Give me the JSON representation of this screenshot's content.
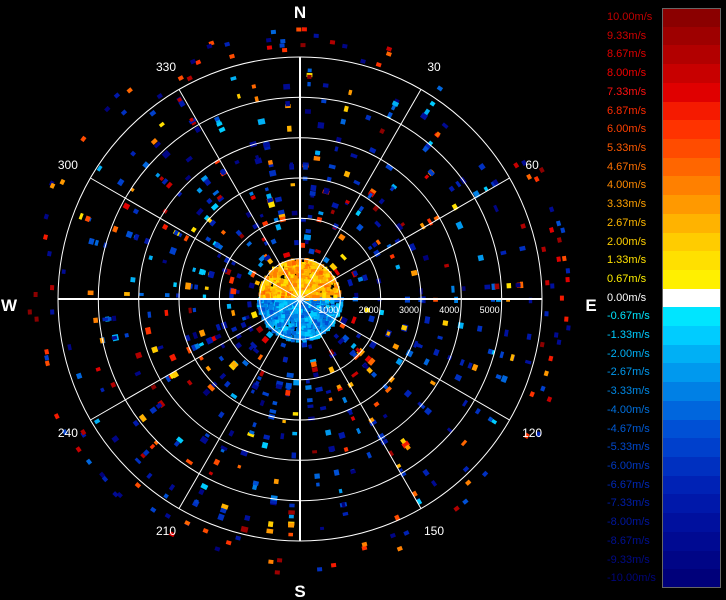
{
  "chart_data": {
    "type": "polar-radar-velocity",
    "compass": {
      "north": "N",
      "east": "E",
      "south": "S",
      "west": "W"
    },
    "angle_labels": [
      {
        "angle": 30,
        "text": "30"
      },
      {
        "angle": 60,
        "text": "60"
      },
      {
        "angle": 120,
        "text": "120"
      },
      {
        "angle": 150,
        "text": "150"
      },
      {
        "angle": 210,
        "text": "210"
      },
      {
        "angle": 240,
        "text": "240"
      },
      {
        "angle": 300,
        "text": "300"
      },
      {
        "angle": 330,
        "text": "330"
      }
    ],
    "range_labels": [
      "1000",
      "2000",
      "3000",
      "4000",
      "5000"
    ],
    "rings": 6,
    "legend": {
      "unit": "m/s",
      "entries": [
        {
          "label": "10.00m/s",
          "color": "#8b0000",
          "text_color": "#c00000"
        },
        {
          "label": "9.33m/s",
          "color": "#9e0000",
          "text_color": "#d00000"
        },
        {
          "label": "8.67m/s",
          "color": "#b20000",
          "text_color": "#e00000"
        },
        {
          "label": "8.00m/s",
          "color": "#c80000",
          "text_color": "#f00000"
        },
        {
          "label": "7.33m/s",
          "color": "#e00000",
          "text_color": "#ff1010"
        },
        {
          "label": "6.87m/s",
          "color": "#f51a00",
          "text_color": "#ff2a00"
        },
        {
          "label": "6.00m/s",
          "color": "#ff3300",
          "text_color": "#ff4000"
        },
        {
          "label": "5.33m/s",
          "color": "#ff4c00",
          "text_color": "#ff5a00"
        },
        {
          "label": "4.67m/s",
          "color": "#ff6600",
          "text_color": "#ff7000"
        },
        {
          "label": "4.00m/s",
          "color": "#ff8000",
          "text_color": "#ff8a00"
        },
        {
          "label": "3.33m/s",
          "color": "#ff9900",
          "text_color": "#ffa000"
        },
        {
          "label": "2.67m/s",
          "color": "#ffb300",
          "text_color": "#ffb800"
        },
        {
          "label": "2.00m/s",
          "color": "#ffcc00",
          "text_color": "#ffd000"
        },
        {
          "label": "1.33m/s",
          "color": "#ffe000",
          "text_color": "#ffe000"
        },
        {
          "label": "0.67m/s",
          "color": "#fff000",
          "text_color": "#fff000"
        },
        {
          "label": "0.00m/s",
          "color": "#ffffff",
          "text_color": "#ffffff"
        },
        {
          "label": "-0.67m/s",
          "color": "#00e5ff",
          "text_color": "#00e5ff"
        },
        {
          "label": "-1.33m/s",
          "color": "#00ccff",
          "text_color": "#00ccff"
        },
        {
          "label": "-2.00m/s",
          "color": "#00b0f5",
          "text_color": "#00b0f5"
        },
        {
          "label": "-2.67m/s",
          "color": "#0099ee",
          "text_color": "#0099ee"
        },
        {
          "label": "-3.33m/s",
          "color": "#0080e5",
          "text_color": "#0088e5"
        },
        {
          "label": "-4.00m/s",
          "color": "#0066dd",
          "text_color": "#0070dd"
        },
        {
          "label": "-4.67m/s",
          "color": "#0050d5",
          "text_color": "#005ad5"
        },
        {
          "label": "-5.33m/s",
          "color": "#0040cc",
          "text_color": "#0048cc"
        },
        {
          "label": "-6.00m/s",
          "color": "#0030c0",
          "text_color": "#0038c0"
        },
        {
          "label": "-6.67m/s",
          "color": "#0022b5",
          "text_color": "#0028b5"
        },
        {
          "label": "-7.33m/s",
          "color": "#0018aa",
          "text_color": "#001eaa"
        },
        {
          "label": "-8.00m/s",
          "color": "#00109e",
          "text_color": "#00169e"
        },
        {
          "label": "-8.67m/s",
          "color": "#000a92",
          "text_color": "#001092"
        },
        {
          "label": "-9.33m/s",
          "color": "#000586",
          "text_color": "#000a86"
        },
        {
          "label": "-10.00m/s",
          "color": "#00007a",
          "text_color": "#00057a"
        }
      ]
    }
  }
}
